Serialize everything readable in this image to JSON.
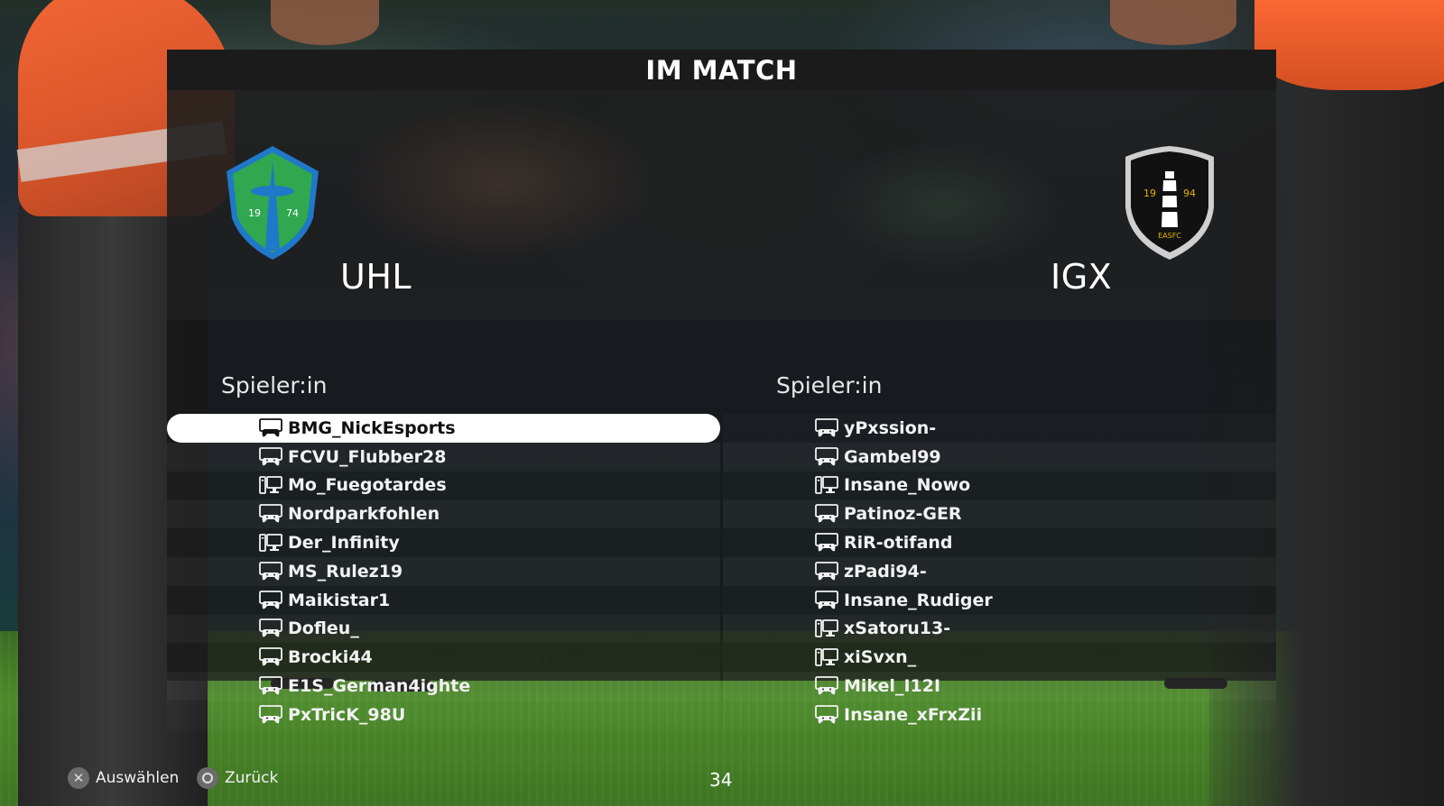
{
  "screen": {
    "title": "IM MATCH"
  },
  "home_team": {
    "name": "UHL",
    "crest_year_left": "19",
    "crest_year_right": "74",
    "column_header": "Spieler:in",
    "players": [
      {
        "name": "BMG_NickEsports",
        "platform": "console",
        "selected": true
      },
      {
        "name": "FCVU_Flubber28",
        "platform": "console",
        "selected": false
      },
      {
        "name": "Mo_Fuegotardes",
        "platform": "pc",
        "selected": false
      },
      {
        "name": "Nordparkfohlen",
        "platform": "console",
        "selected": false
      },
      {
        "name": "Der_Infinity",
        "platform": "pc",
        "selected": false
      },
      {
        "name": "MS_Rulez19",
        "platform": "console",
        "selected": false
      },
      {
        "name": "Maikistar1",
        "platform": "console",
        "selected": false
      },
      {
        "name": "Dofleu_",
        "platform": "console",
        "selected": false
      },
      {
        "name": "Brocki44",
        "platform": "console",
        "selected": false
      },
      {
        "name": "E1S_German4ighte",
        "platform": "console",
        "selected": false
      },
      {
        "name": "PxTricK_98U",
        "platform": "console",
        "selected": false
      }
    ]
  },
  "away_team": {
    "name": "IGX",
    "crest_year_left": "19",
    "crest_year_right": "94",
    "crest_text": "EASFC",
    "column_header": "Spieler:in",
    "players": [
      {
        "name": "yPxssion-",
        "platform": "console"
      },
      {
        "name": "Gambel99",
        "platform": "console"
      },
      {
        "name": "Insane_Nowo",
        "platform": "pc"
      },
      {
        "name": "Patinoz-GER",
        "platform": "console"
      },
      {
        "name": "RiR-otifand",
        "platform": "console"
      },
      {
        "name": "zPadi94-",
        "platform": "console"
      },
      {
        "name": "Insane_Rudiger",
        "platform": "console"
      },
      {
        "name": "xSatoru13-",
        "platform": "pc"
      },
      {
        "name": "xiSvxn_",
        "platform": "pc"
      },
      {
        "name": "Mikel_I12I",
        "platform": "console"
      },
      {
        "name": "Insane_xFrxZii",
        "platform": "console"
      }
    ]
  },
  "footer": {
    "select_label": "Auswählen",
    "select_icon": "cross-button-icon",
    "back_label": "Zurück",
    "back_icon": "circle-button-icon",
    "page_number": "34"
  },
  "colors": {
    "home_crest_green": "#2fa84f",
    "home_crest_blue": "#1f78c8",
    "away_crest_black": "#111111",
    "selection": "#ffffff"
  }
}
